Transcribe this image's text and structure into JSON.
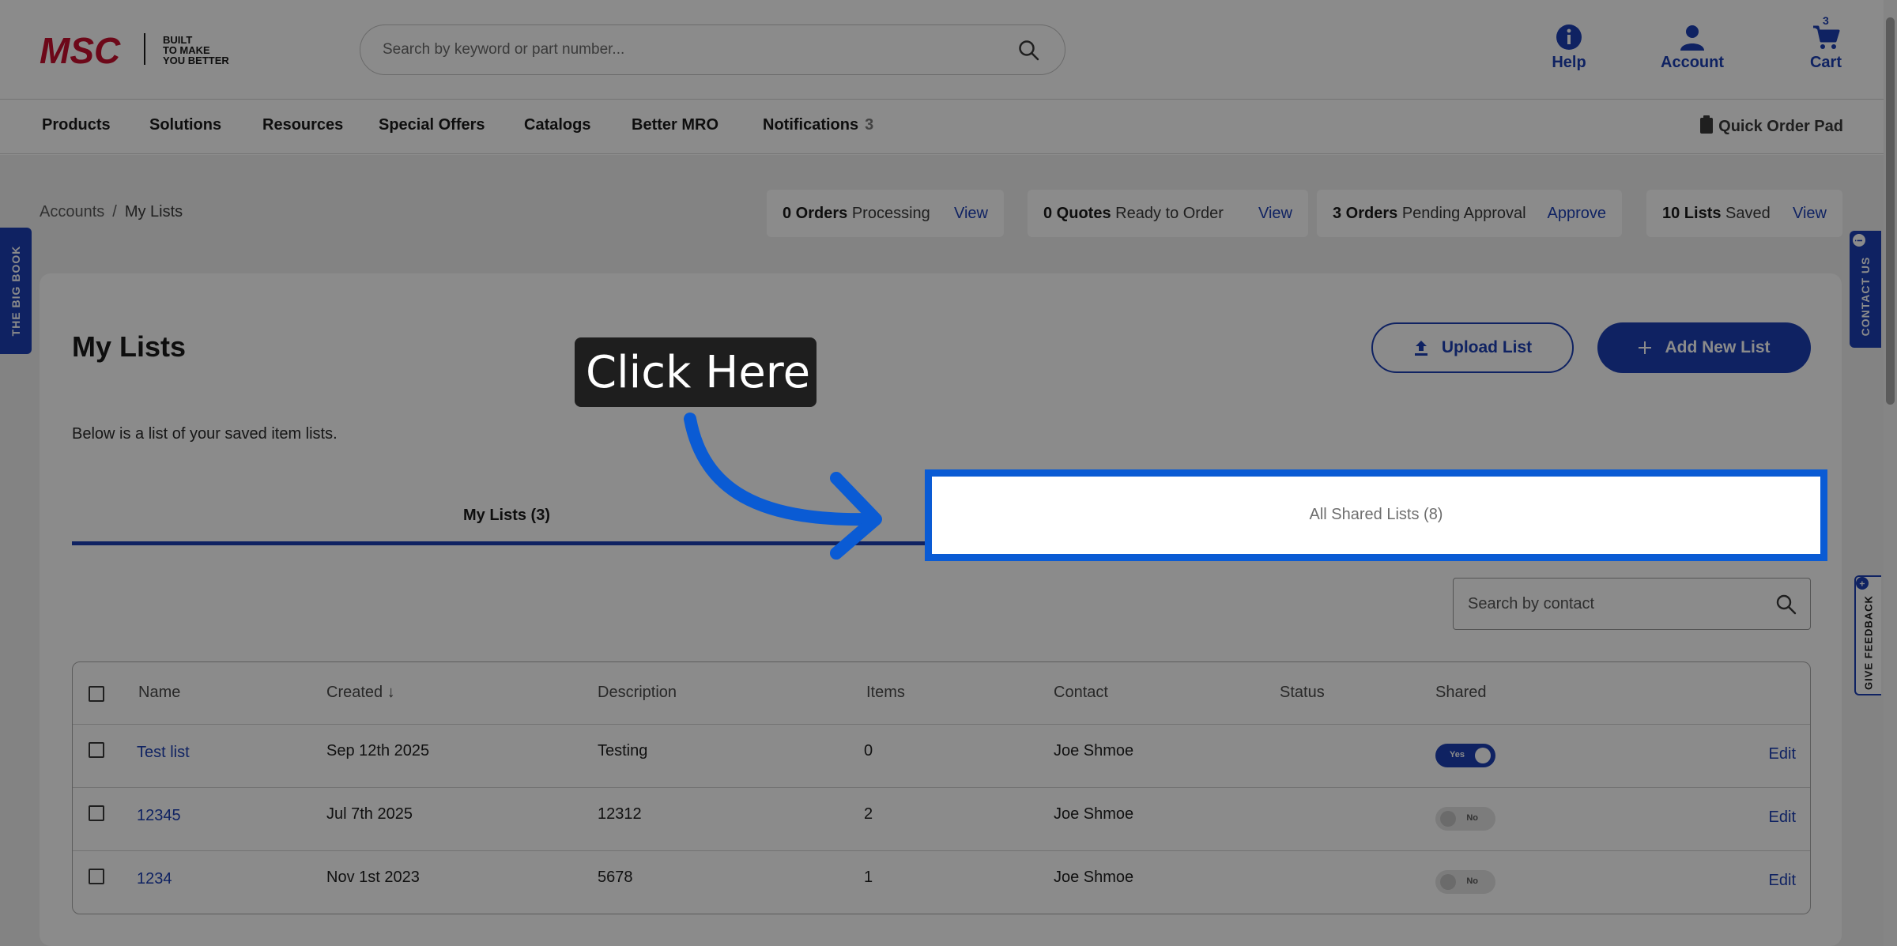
{
  "header": {
    "logo_text": "MSC",
    "logo_tagline": [
      "BUILT",
      "TO MAKE",
      "YOU BETTER"
    ],
    "search_placeholder": "Search by keyword or part number...",
    "help_label": "Help",
    "account_label": "Account",
    "cart_label": "Cart",
    "cart_count": "3",
    "accent_color": "#1c3fb4"
  },
  "nav": {
    "items": [
      "Products",
      "Solutions",
      "Resources",
      "Special Offers",
      "Catalogs",
      "Better MRO",
      "Notifications"
    ],
    "notifications_count": "3",
    "quick_order": "Quick Order Pad"
  },
  "breadcrumb": {
    "parent": "Accounts",
    "separator": "/",
    "current": "My Lists"
  },
  "stats": [
    {
      "bold": "0 Orders",
      "text": "Processing",
      "action": "View"
    },
    {
      "bold": "0 Quotes",
      "text": "Ready to Order",
      "action": "View"
    },
    {
      "bold": "3 Orders",
      "text": "Pending Approval",
      "action": "Approve"
    },
    {
      "bold": "10 Lists",
      "text": "Saved",
      "action": "View"
    }
  ],
  "main": {
    "title": "My Lists",
    "description": "Below is a list of your saved item lists.",
    "upload_label": "Upload List",
    "add_label": "Add New List",
    "tabs": [
      {
        "label": "My Lists (3)"
      },
      {
        "label": "All Shared Lists (8)"
      }
    ],
    "contact_search_placeholder": "Search by contact"
  },
  "table": {
    "headers": [
      "Name",
      "Created",
      "Description",
      "Items",
      "Contact",
      "Status",
      "Shared"
    ],
    "sort_indicator": "↓",
    "rows": [
      {
        "name": "Test list",
        "created": "Sep 12th 2025",
        "description": "Testing",
        "items": "0",
        "contact": "Joe Shmoe",
        "status": "",
        "shared": "Yes",
        "edit": "Edit"
      },
      {
        "name": "12345",
        "created": "Jul 7th 2025",
        "description": "12312",
        "items": "2",
        "contact": "Joe Shmoe",
        "status": "",
        "shared": "No",
        "edit": "Edit"
      },
      {
        "name": "1234",
        "created": "Nov 1st 2023",
        "description": "5678",
        "items": "1",
        "contact": "Joe Shmoe",
        "status": "",
        "shared": "No",
        "edit": "Edit"
      }
    ]
  },
  "side": {
    "big_book": "THE BIG BOOK",
    "contact_us": "CONTACT US",
    "feedback": "GIVE FEEDBACK"
  },
  "callout": {
    "text": "Click Here"
  },
  "colors": {
    "accent": "#1c3fb4",
    "highlight": "#0a5bd4",
    "logo_red": "#c8102e"
  }
}
